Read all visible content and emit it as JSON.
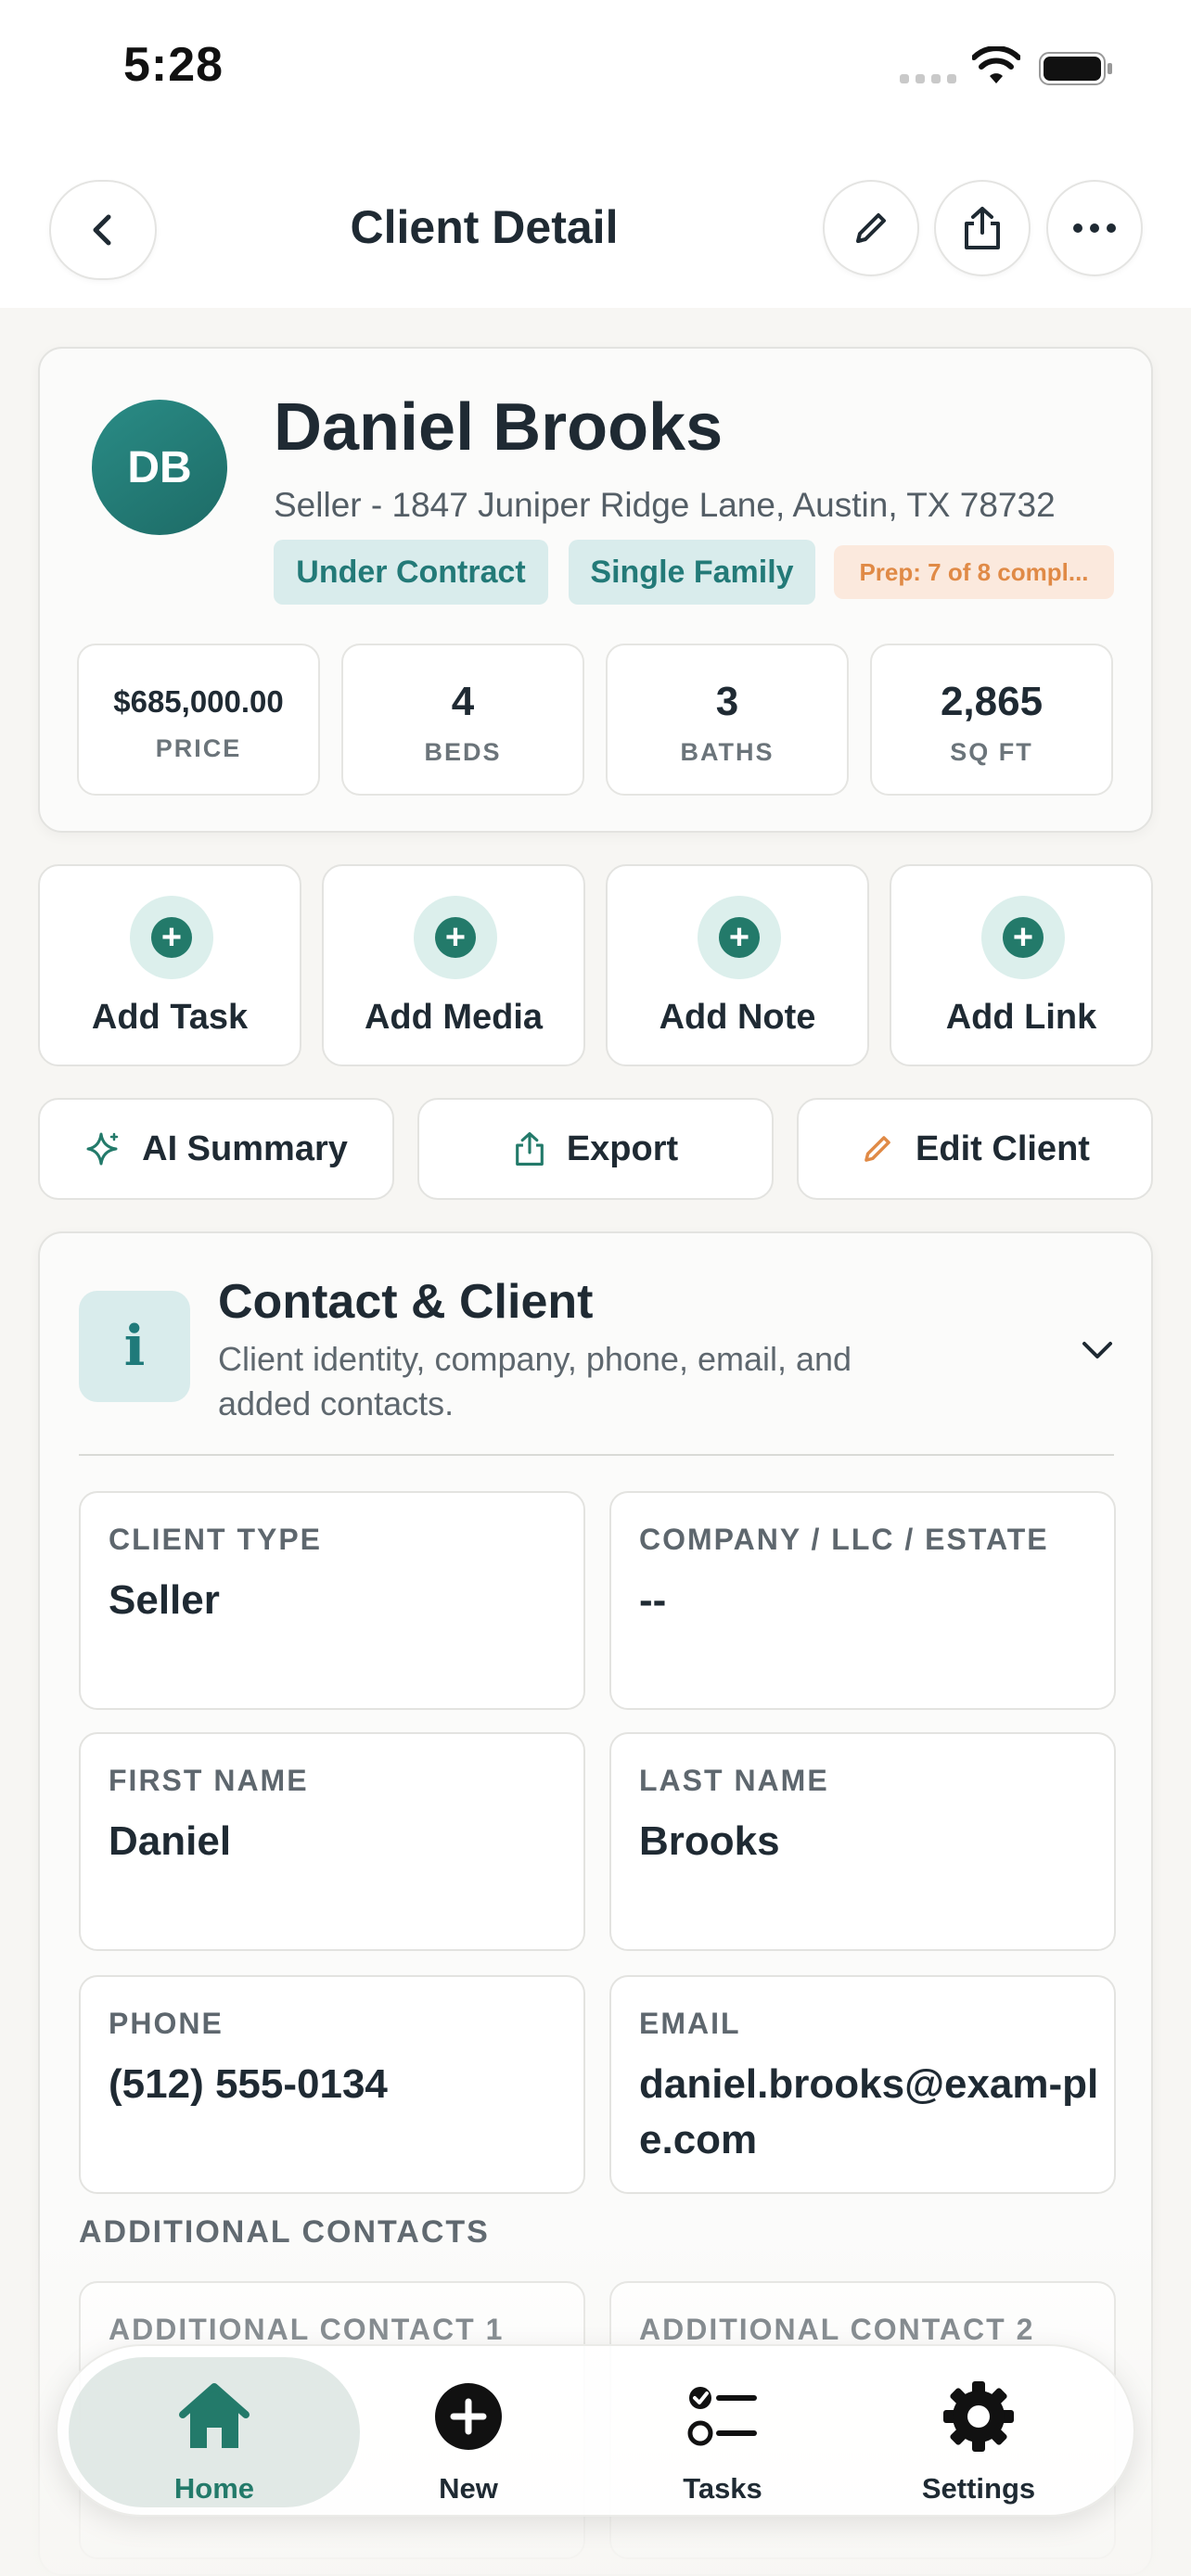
{
  "status": {
    "time": "5:28"
  },
  "nav": {
    "title": "Client Detail"
  },
  "client": {
    "initials": "DB",
    "name": "Daniel Brooks",
    "subtitle": "Seller - 1847 Juniper Ridge Lane, Austin, TX 78732",
    "badges": [
      "Under Contract",
      "Single Family",
      "Prep: 7 of 8 compl..."
    ],
    "stats": [
      {
        "value": "$685,000.00",
        "label": "PRICE"
      },
      {
        "value": "4",
        "label": "BEDS"
      },
      {
        "value": "3",
        "label": "BATHS"
      },
      {
        "value": "2,865",
        "label": "SQ FT"
      }
    ]
  },
  "quick_actions": [
    "Add Task",
    "Add Media",
    "Add Note",
    "Add Link"
  ],
  "actions": [
    "AI Summary",
    "Export",
    "Edit Client"
  ],
  "section": {
    "icon": "i",
    "title": "Contact & Client",
    "description": "Client identity, company, phone, email, and added contacts.",
    "fields": [
      {
        "label": "CLIENT TYPE",
        "value": "Seller"
      },
      {
        "label": "COMPANY / LLC / ESTATE",
        "value": "--"
      },
      {
        "label": "FIRST NAME",
        "value": "Daniel"
      },
      {
        "label": "LAST NAME",
        "value": "Brooks"
      },
      {
        "label": "PHONE",
        "value": "(512) 555-0134"
      },
      {
        "label": "EMAIL",
        "value": "daniel.brooks@exam-ple.com"
      }
    ],
    "additional_heading": "ADDITIONAL CONTACTS",
    "additional": [
      {
        "label": "ADDITIONAL CONTACT 1"
      },
      {
        "label": "ADDITIONAL CONTACT 2"
      }
    ]
  },
  "tabs": [
    "Home",
    "New",
    "Tasks",
    "Settings"
  ],
  "colors": {
    "accent": "#237a6a",
    "badge_bg": "#d9ecec",
    "prep_text": "#e08a46",
    "prep_bg": "#fbe9dd"
  },
  "icons": {
    "back": "chevron-left-icon",
    "edit": "pencil-icon",
    "share": "share-icon",
    "more": "ellipsis-icon",
    "ai": "sparkle-icon",
    "export": "share-icon",
    "edit_client": "pencil-icon",
    "expand": "chevron-down-icon",
    "home": "house-icon",
    "new": "plus-circle-icon",
    "tasks": "checklist-icon",
    "settings": "gear-icon"
  }
}
